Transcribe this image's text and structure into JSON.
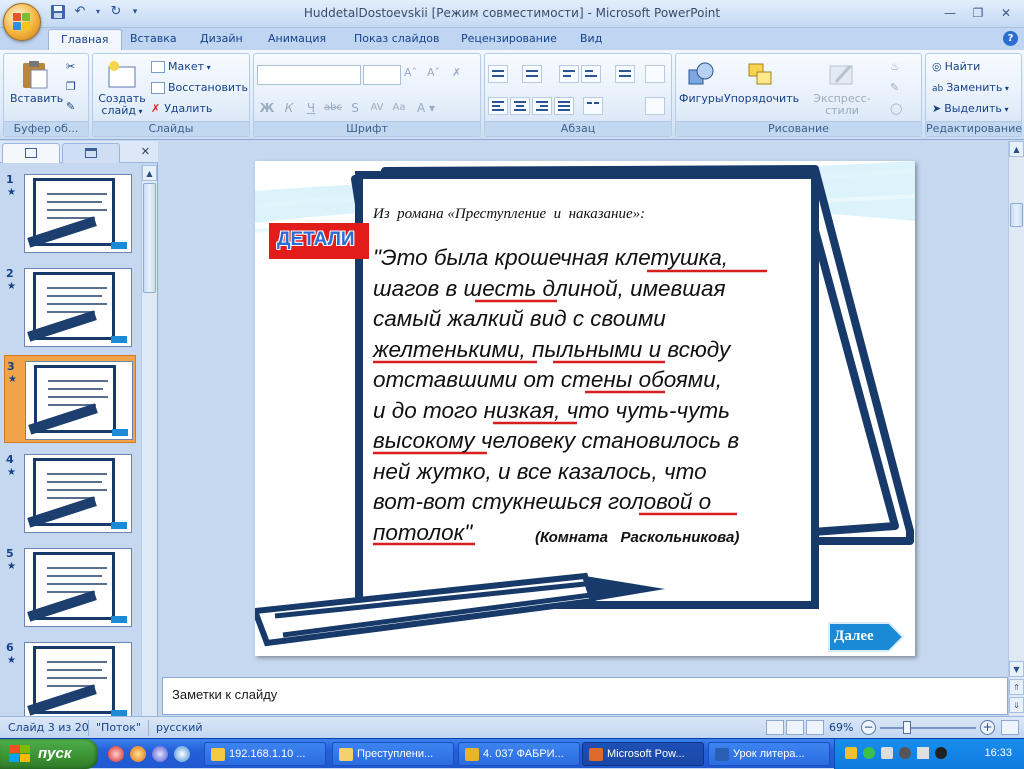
{
  "window": {
    "title": "HuddetalDostoevskii [Режим совместимости] - Microsoft PowerPoint",
    "controls": [
      "minimize",
      "maximize",
      "close"
    ]
  },
  "qat": {
    "icons": [
      "save-icon",
      "undo-icon",
      "redo-icon",
      "customize-icon"
    ]
  },
  "ribbon": {
    "tabs": [
      "Главная",
      "Вставка",
      "Дизайн",
      "Анимация",
      "Показ слайдов",
      "Рецензирование",
      "Вид"
    ],
    "active_tab": "Главная",
    "clipboard": {
      "label": "Буфер об...",
      "paste": "Вставить"
    },
    "slides": {
      "label": "Слайды",
      "new_slide_1": "Создать",
      "new_slide_2": "слайд",
      "layout": "Макет",
      "reset": "Восстановить",
      "delete": "Удалить"
    },
    "font": {
      "label": "Шрифт",
      "bold": "Ж",
      "italic": "К",
      "underline": "Ч",
      "strike": "abc",
      "shadow": "S",
      "spacing": "AV",
      "case": "Aa"
    },
    "paragraph": {
      "label": "Абзац"
    },
    "drawing": {
      "label": "Рисование",
      "shapes": "Фигуры",
      "arrange": "Упорядочить",
      "styles": "Экспресс-стили"
    },
    "editing": {
      "label": "Редактирование",
      "find": "Найти",
      "replace": "Заменить",
      "select": "Выделить"
    }
  },
  "thumbnails": [
    {
      "num": "1",
      "selected": false
    },
    {
      "num": "2",
      "selected": false
    },
    {
      "num": "3",
      "selected": true
    },
    {
      "num": "4",
      "selected": false
    },
    {
      "num": "5",
      "selected": false
    },
    {
      "num": "6",
      "selected": false
    }
  ],
  "slide": {
    "badge": "ДЕТАЛИ",
    "source": "Из  романа «Преступление  и  наказание»:",
    "quote_lines": [
      "\"Это была крошечная клетушка,",
      "шагов в шесть длиной, имевшая",
      "самый жалкий вид с своими",
      "желтенькими, пыльными и всюду",
      "отставшими от стены обоями,",
      "и до того низкая, что чуть-чуть",
      "высокому человеку становилось в",
      "ней жутко, и все казалось, что",
      "вот-вот стукнешься головой о",
      "потолок\""
    ],
    "caption": "(Комната   Раскольникова)",
    "next_button": "Далее"
  },
  "notes": {
    "placeholder": "Заметки к слайду"
  },
  "status": {
    "slide_counter": "Слайд 3 из 20",
    "theme": "\"Поток\"",
    "language": "русский",
    "zoom": "69%",
    "zoom_fraction": 0.25
  },
  "taskbar": {
    "start": "пуск",
    "tasks": [
      {
        "label": "192.168.1.10 ...",
        "active": false
      },
      {
        "label": "Преступлени...",
        "active": false
      },
      {
        "label": "4. 037 ФАБРИ...",
        "active": false
      },
      {
        "label": "Microsoft Pow...",
        "active": true
      },
      {
        "label": "Урок литера...",
        "active": false
      }
    ],
    "language": "RU",
    "clock": "16:33"
  },
  "colors": {
    "accent_orange": "#f1a34a",
    "frame_navy": "#173a6a",
    "underline_red": "#d81e1e",
    "badge_red": "#e21b1b",
    "next_blue": "#1a8ad6"
  }
}
